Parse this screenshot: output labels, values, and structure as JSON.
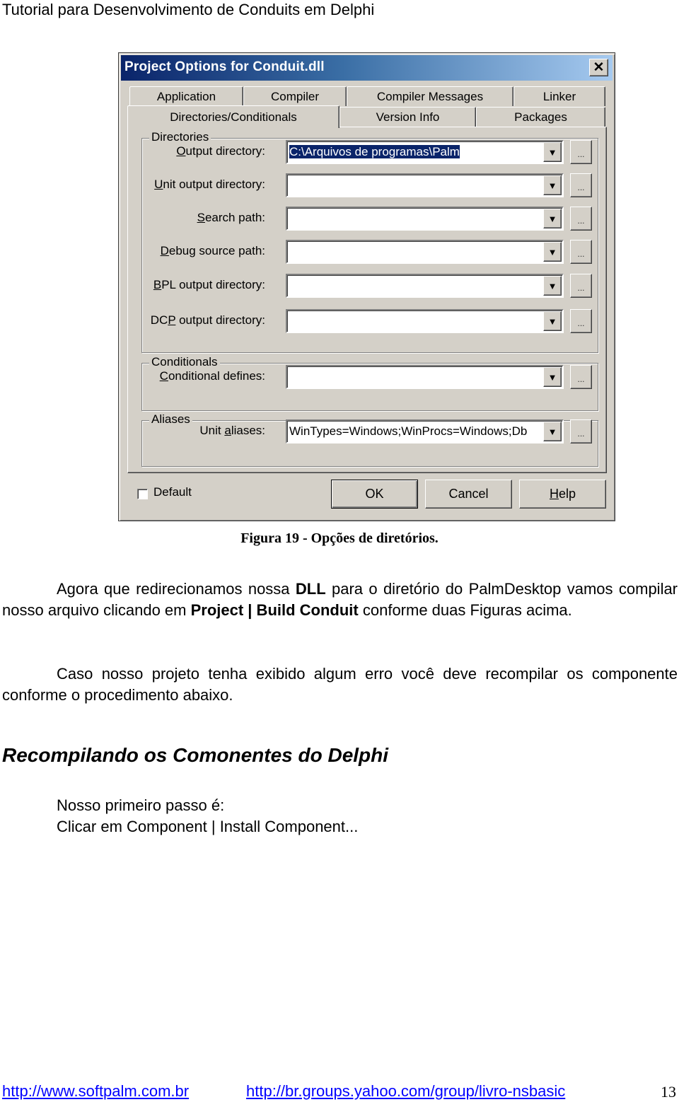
{
  "page": {
    "header": "Tutorial para Desenvolvimento de Conduits em Delphi",
    "caption": "Figura 19 - Opções de diretórios.",
    "paragraph1": {
      "t1": "Agora que redirecionamos nossa ",
      "b1": "DLL",
      "t2": " para o diretório do PalmDesktop vamos compilar nosso arquivo clicando em ",
      "b2": "Project | Build Conduit",
      "t3": " conforme duas Figuras acima."
    },
    "paragraph2": "Caso nosso projeto tenha exibido algum erro você deve recompilar os componente conforme o procedimento abaixo.",
    "section_title": "Recompilando os Comonentes do Delphi",
    "steps": [
      "Nosso primeiro passo é:",
      "Clicar em Component | Install Component..."
    ],
    "footer": {
      "link1": "http://www.softpalm.com.br",
      "link2": "http://br.groups.yahoo.com/group/livro-nsbasic",
      "page_number": "13"
    }
  },
  "dialog": {
    "title": "Project Options for Conduit.dll",
    "close_icon": "close-x-icon",
    "tabs_row1": [
      "Application",
      "Compiler",
      "Compiler Messages",
      "Linker"
    ],
    "tabs_row2": [
      "Directories/Conditionals",
      "Version Info",
      "Packages"
    ],
    "active_tab": "Directories/Conditionals",
    "groups": {
      "directories": "Directories",
      "conditionals": "Conditionals",
      "aliases": "Aliases"
    },
    "fields": [
      {
        "label_pre": "",
        "label_key": "O",
        "label_post": "utput directory:",
        "value": "C:\\Arquivos de programas\\Palm"
      },
      {
        "label_pre": "",
        "label_key": "U",
        "label_post": "nit output directory:",
        "value": ""
      },
      {
        "label_pre": "",
        "label_key": "S",
        "label_post": "earch path:",
        "value": ""
      },
      {
        "label_pre": "",
        "label_key": "D",
        "label_post": "ebug source path:",
        "value": ""
      },
      {
        "label_pre": "",
        "label_key": "B",
        "label_post": "PL output directory:",
        "value": ""
      },
      {
        "label_pre": "DC",
        "label_key": "P",
        "label_post": " output directory:",
        "value": ""
      },
      {
        "label_pre": "",
        "label_key": "C",
        "label_post": "onditional defines:",
        "value": ""
      },
      {
        "label_pre": "Unit ",
        "label_key": "a",
        "label_post": "liases:",
        "value": "WinTypes=Windows;WinProcs=Windows;Db"
      }
    ],
    "ellipsis_label": "...",
    "dropdown_glyph": "▼",
    "default_checkbox": {
      "label": "Default",
      "checked": false
    },
    "buttons": {
      "ok": "OK",
      "cancel": "Cancel",
      "help_key": "H",
      "help_rest": "elp"
    }
  }
}
